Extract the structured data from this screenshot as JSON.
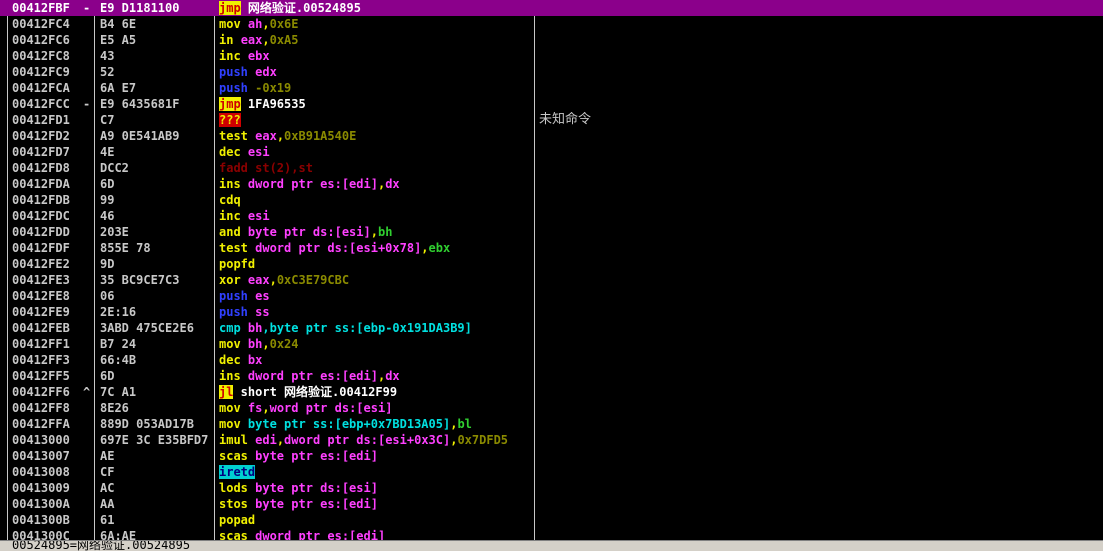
{
  "colors": {
    "selected_row": "#8b008b",
    "background": "#000000",
    "default_text": "#c8c8c8"
  },
  "rows": [
    {
      "addr": "00412FBF",
      "mark": "-",
      "hex": "E9 D1181100",
      "dis": [
        {
          "t": "jmp",
          "c": "b-jmp"
        },
        {
          "t": " 网络验证.00524895",
          "c": "c-white"
        }
      ],
      "comment": "",
      "selected": true
    },
    {
      "addr": "00412FC4",
      "mark": "",
      "hex": "B4 6E",
      "dis": [
        {
          "t": "mov ",
          "c": "c-yellow"
        },
        {
          "t": "ah",
          "c": "c-mag"
        },
        {
          "t": ",",
          "c": "c-yellow"
        },
        {
          "t": "0x6E",
          "c": "c-olive"
        }
      ],
      "comment": ""
    },
    {
      "addr": "00412FC6",
      "mark": "",
      "hex": "E5 A5",
      "dis": [
        {
          "t": "in ",
          "c": "c-yellow"
        },
        {
          "t": "eax",
          "c": "c-mag"
        },
        {
          "t": ",",
          "c": "c-yellow"
        },
        {
          "t": "0xA5",
          "c": "c-olive"
        }
      ],
      "comment": ""
    },
    {
      "addr": "00412FC8",
      "mark": "",
      "hex": "43",
      "dis": [
        {
          "t": "inc ",
          "c": "c-yellow"
        },
        {
          "t": "ebx",
          "c": "c-mag"
        }
      ],
      "comment": ""
    },
    {
      "addr": "00412FC9",
      "mark": "",
      "hex": "52",
      "dis": [
        {
          "t": "push ",
          "c": "c-blue"
        },
        {
          "t": "edx",
          "c": "c-mag"
        }
      ],
      "comment": ""
    },
    {
      "addr": "00412FCA",
      "mark": "",
      "hex": "6A E7",
      "dis": [
        {
          "t": "push ",
          "c": "c-blue"
        },
        {
          "t": "-0x19",
          "c": "c-olive"
        }
      ],
      "comment": ""
    },
    {
      "addr": "00412FCC",
      "mark": "-",
      "hex": "E9 6435681F",
      "dis": [
        {
          "t": "jmp",
          "c": "b-jmp"
        },
        {
          "t": " 1FA96535",
          "c": "c-white"
        }
      ],
      "comment": ""
    },
    {
      "addr": "00412FD1",
      "mark": "",
      "hex": "C7",
      "dis": [
        {
          "t": "???",
          "c": "b-unk"
        }
      ],
      "comment": "未知命令"
    },
    {
      "addr": "00412FD2",
      "mark": "",
      "hex": "A9 0E541AB9",
      "dis": [
        {
          "t": "test ",
          "c": "c-yellow"
        },
        {
          "t": "eax",
          "c": "c-mag"
        },
        {
          "t": ",",
          "c": "c-yellow"
        },
        {
          "t": "0xB91A540E",
          "c": "c-olive"
        }
      ],
      "comment": ""
    },
    {
      "addr": "00412FD7",
      "mark": "",
      "hex": "4E",
      "dis": [
        {
          "t": "dec ",
          "c": "c-yellow"
        },
        {
          "t": "esi",
          "c": "c-mag"
        }
      ],
      "comment": ""
    },
    {
      "addr": "00412FD8",
      "mark": "",
      "hex": "DCC2",
      "dis": [
        {
          "t": "fadd st(2),st",
          "c": "c-red"
        }
      ],
      "comment": ""
    },
    {
      "addr": "00412FDA",
      "mark": "",
      "hex": "6D",
      "dis": [
        {
          "t": "ins ",
          "c": "c-yellow"
        },
        {
          "t": "dword ptr es:[edi]",
          "c": "c-mag"
        },
        {
          "t": ",",
          "c": "c-yellow"
        },
        {
          "t": "dx",
          "c": "c-mag"
        }
      ],
      "comment": ""
    },
    {
      "addr": "00412FDB",
      "mark": "",
      "hex": "99",
      "dis": [
        {
          "t": "cdq",
          "c": "c-yellow"
        }
      ],
      "comment": ""
    },
    {
      "addr": "00412FDC",
      "mark": "",
      "hex": "46",
      "dis": [
        {
          "t": "inc ",
          "c": "c-yellow"
        },
        {
          "t": "esi",
          "c": "c-mag"
        }
      ],
      "comment": ""
    },
    {
      "addr": "00412FDD",
      "mark": "",
      "hex": "203E",
      "dis": [
        {
          "t": "and ",
          "c": "c-yellow"
        },
        {
          "t": "byte ptr ds:[esi]",
          "c": "c-mag"
        },
        {
          "t": ",",
          "c": "c-yellow"
        },
        {
          "t": "bh",
          "c": "c-green"
        }
      ],
      "comment": ""
    },
    {
      "addr": "00412FDF",
      "mark": "",
      "hex": "855E 78",
      "dis": [
        {
          "t": "test ",
          "c": "c-yellow"
        },
        {
          "t": "dword ptr ds:[esi+0x78]",
          "c": "c-mag"
        },
        {
          "t": ",",
          "c": "c-yellow"
        },
        {
          "t": "ebx",
          "c": "c-green"
        }
      ],
      "comment": ""
    },
    {
      "addr": "00412FE2",
      "mark": "",
      "hex": "9D",
      "dis": [
        {
          "t": "popfd",
          "c": "c-yellow"
        }
      ],
      "comment": ""
    },
    {
      "addr": "00412FE3",
      "mark": "",
      "hex": "35 BC9CE7C3",
      "dis": [
        {
          "t": "xor ",
          "c": "c-yellow"
        },
        {
          "t": "eax",
          "c": "c-mag"
        },
        {
          "t": ",",
          "c": "c-yellow"
        },
        {
          "t": "0xC3E79CBC",
          "c": "c-olive"
        }
      ],
      "comment": ""
    },
    {
      "addr": "00412FE8",
      "mark": "",
      "hex": "06",
      "dis": [
        {
          "t": "push ",
          "c": "c-blue"
        },
        {
          "t": "es",
          "c": "c-mag"
        }
      ],
      "comment": ""
    },
    {
      "addr": "00412FE9",
      "mark": "",
      "hex": "2E:16",
      "dis": [
        {
          "t": "push ",
          "c": "c-blue"
        },
        {
          "t": "ss",
          "c": "c-mag"
        }
      ],
      "comment": ""
    },
    {
      "addr": "00412FEB",
      "mark": "",
      "hex": "3ABD 475CE2E6",
      "dis": [
        {
          "t": "cmp ",
          "c": "c-cyan"
        },
        {
          "t": "bh",
          "c": "c-mag"
        },
        {
          "t": ",",
          "c": "c-cyan"
        },
        {
          "t": "byte ptr ss:[ebp-0x191DA3B9]",
          "c": "c-cyan"
        }
      ],
      "comment": ""
    },
    {
      "addr": "00412FF1",
      "mark": "",
      "hex": "B7 24",
      "dis": [
        {
          "t": "mov ",
          "c": "c-yellow"
        },
        {
          "t": "bh",
          "c": "c-mag"
        },
        {
          "t": ",",
          "c": "c-yellow"
        },
        {
          "t": "0x24",
          "c": "c-olive"
        }
      ],
      "comment": ""
    },
    {
      "addr": "00412FF3",
      "mark": "",
      "hex": "66:4B",
      "dis": [
        {
          "t": "dec ",
          "c": "c-yellow"
        },
        {
          "t": "bx",
          "c": "c-mag"
        }
      ],
      "comment": ""
    },
    {
      "addr": "00412FF5",
      "mark": "",
      "hex": "6D",
      "dis": [
        {
          "t": "ins ",
          "c": "c-yellow"
        },
        {
          "t": "dword ptr es:[edi]",
          "c": "c-mag"
        },
        {
          "t": ",",
          "c": "c-yellow"
        },
        {
          "t": "dx",
          "c": "c-mag"
        }
      ],
      "comment": ""
    },
    {
      "addr": "00412FF6",
      "mark": "^",
      "hex": "7C A1",
      "dis": [
        {
          "t": "jl",
          "c": "b-jmp"
        },
        {
          "t": " short 网络验证.00412F99",
          "c": "c-white"
        }
      ],
      "comment": ""
    },
    {
      "addr": "00412FF8",
      "mark": "",
      "hex": "8E26",
      "dis": [
        {
          "t": "mov ",
          "c": "c-yellow"
        },
        {
          "t": "fs",
          "c": "c-mag"
        },
        {
          "t": ",",
          "c": "c-yellow"
        },
        {
          "t": "word ptr ds:[esi]",
          "c": "c-mag"
        }
      ],
      "comment": ""
    },
    {
      "addr": "00412FFA",
      "mark": "",
      "hex": "889D 053AD17B",
      "dis": [
        {
          "t": "mov ",
          "c": "c-yellow"
        },
        {
          "t": "byte ptr ss:[ebp+0x7BD13A05]",
          "c": "c-cyan"
        },
        {
          "t": ",",
          "c": "c-yellow"
        },
        {
          "t": "bl",
          "c": "c-green"
        }
      ],
      "comment": ""
    },
    {
      "addr": "00413000",
      "mark": "",
      "hex": "697E 3C E35BFD7",
      "dis": [
        {
          "t": "imul ",
          "c": "c-yellow"
        },
        {
          "t": "edi",
          "c": "c-mag"
        },
        {
          "t": ",",
          "c": "c-yellow"
        },
        {
          "t": "dword ptr ds:[esi+0x3C]",
          "c": "c-mag"
        },
        {
          "t": ",",
          "c": "c-yellow"
        },
        {
          "t": "0x7DFD5",
          "c": "c-olive"
        }
      ],
      "comment": ""
    },
    {
      "addr": "00413007",
      "mark": "",
      "hex": "AE",
      "dis": [
        {
          "t": "scas ",
          "c": "c-yellow"
        },
        {
          "t": "byte ptr es:[edi]",
          "c": "c-mag"
        }
      ],
      "comment": ""
    },
    {
      "addr": "00413008",
      "mark": "",
      "hex": "CF",
      "dis": [
        {
          "t": "iretd",
          "c": "b-iretd"
        }
      ],
      "comment": ""
    },
    {
      "addr": "00413009",
      "mark": "",
      "hex": "AC",
      "dis": [
        {
          "t": "lods ",
          "c": "c-yellow"
        },
        {
          "t": "byte ptr ds:[esi]",
          "c": "c-mag"
        }
      ],
      "comment": ""
    },
    {
      "addr": "0041300A",
      "mark": "",
      "hex": "AA",
      "dis": [
        {
          "t": "stos ",
          "c": "c-yellow"
        },
        {
          "t": "byte ptr es:[edi]",
          "c": "c-mag"
        }
      ],
      "comment": ""
    },
    {
      "addr": "0041300B",
      "mark": "",
      "hex": "61",
      "dis": [
        {
          "t": "popad",
          "c": "c-yellow"
        }
      ],
      "comment": ""
    },
    {
      "addr": "0041300C",
      "mark": "",
      "hex": "6A:AE",
      "dis": [
        {
          "t": "scas ",
          "c": "c-yellow"
        },
        {
          "t": "dword ptr es:[edi]",
          "c": "c-mag"
        }
      ],
      "comment": ""
    }
  ],
  "status": {
    "text": "00524895=网络验证.00524895"
  }
}
